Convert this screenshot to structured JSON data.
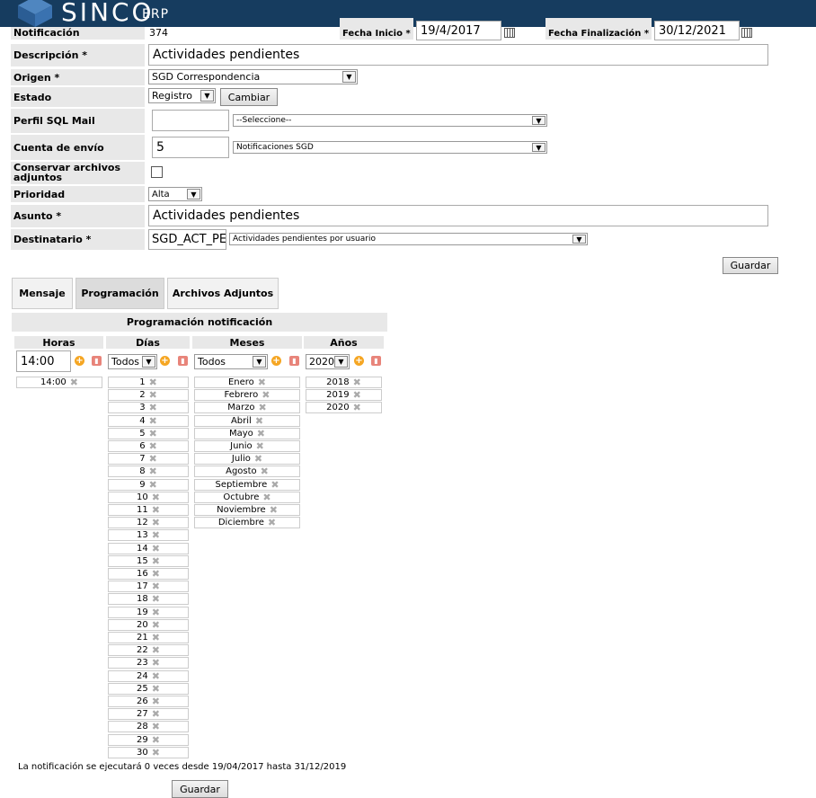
{
  "header": {
    "logo": "SINCO",
    "logo_suffix": "ERP"
  },
  "form": {
    "notificacion_label": "Notificación",
    "notificacion_value": "374",
    "fecha_inicio_label": "Fecha Inicio *",
    "fecha_inicio_value": "19/4/2017",
    "fecha_fin_label": "Fecha Finalización *",
    "fecha_fin_value": "30/12/2021",
    "descripcion_label": "Descripción *",
    "descripcion_value": "Actividades pendientes",
    "origen_label": "Origen *",
    "origen_value": "SGD Correspondencia",
    "estado_label": "Estado",
    "estado_value": "Registro",
    "cambiar_button": "Cambiar",
    "perfil_label": "Perfil SQL Mail",
    "perfil_input": "",
    "perfil_select": "--Seleccione--",
    "cuenta_label": "Cuenta de envío",
    "cuenta_input": "5",
    "cuenta_select": "Notificaciones SGD",
    "conservar_label": "Conservar archivos adjuntos",
    "prioridad_label": "Prioridad",
    "prioridad_value": "Alta",
    "asunto_label": "Asunto *",
    "asunto_value": "Actividades pendientes",
    "destinatario_label": "Destinatario *",
    "destinatario_input": "SGD_ACT_PE",
    "destinatario_select": "Actividades pendientes por usuario",
    "guardar_button": "Guardar"
  },
  "tabs": [
    "Mensaje",
    "Programación",
    "Archivos Adjuntos"
  ],
  "programacion": {
    "title": "Programación notificación",
    "headers": {
      "horas": "Horas",
      "dias": "Días",
      "meses": "Meses",
      "anios": "Años"
    },
    "hora_input": "14:00",
    "dias_select": "Todos",
    "meses_select": "Todos",
    "anios_select": "2020",
    "horas_list": [
      "14:00"
    ],
    "dias_list": [
      "1",
      "2",
      "3",
      "4",
      "5",
      "6",
      "7",
      "8",
      "9",
      "10",
      "11",
      "12",
      "13",
      "14",
      "15",
      "16",
      "17",
      "18",
      "19",
      "20",
      "21",
      "22",
      "23",
      "24",
      "25",
      "26",
      "27",
      "28",
      "29",
      "30"
    ],
    "meses_list": [
      "Enero",
      "Febrero",
      "Marzo",
      "Abril",
      "Mayo",
      "Junio",
      "Julio",
      "Agosto",
      "Septiembre",
      "Octubre",
      "Noviembre",
      "Diciembre"
    ],
    "anios_list": [
      "2018",
      "2019",
      "2020"
    ],
    "summary": "La notificación se ejecutará 0 veces desde 19/04/2017 hasta 31/12/2019",
    "guardar_button": "Guardar"
  },
  "colors": {
    "header_bg": "#163c5f",
    "label_bg": "#e8e8e8",
    "add_icon": "#f5a623",
    "delete_icon": "#e8847a"
  }
}
